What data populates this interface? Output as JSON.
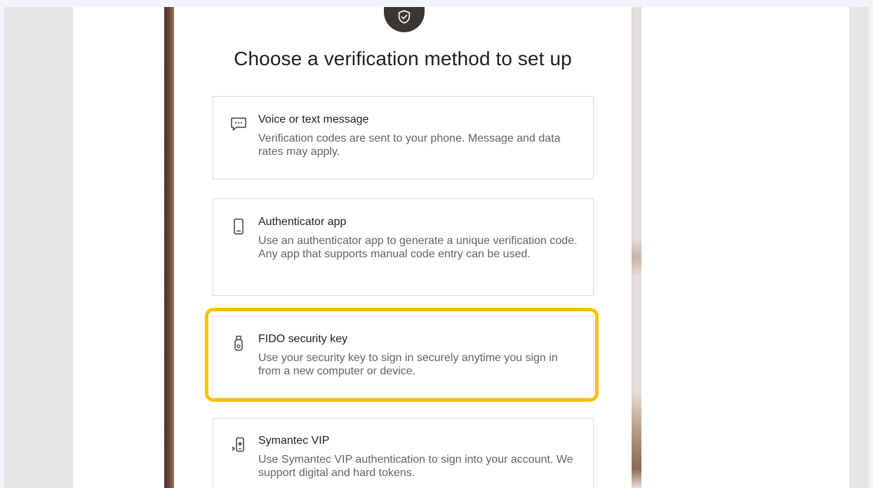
{
  "page": {
    "title": "Choose a verification method to set up"
  },
  "options": [
    {
      "title": "Voice or text message",
      "description": "Verification codes are sent to your phone. Message and data rates may apply.",
      "icon": "message-icon"
    },
    {
      "title": "Authenticator app",
      "description": "Use an authenticator app to generate a unique verification code. Any app that supports manual code entry can be used.",
      "icon": "phone-icon"
    },
    {
      "title": "FIDO security key",
      "description": "Use your security key to sign in securely anytime you sign in from a new computer or device.",
      "icon": "usb-key-icon"
    },
    {
      "title": "Symantec VIP",
      "description": "Use Symantec VIP authentication to sign into your account. We support digital and hard tokens.",
      "icon": "token-icon"
    }
  ],
  "colors": {
    "highlight": "#fcc200",
    "badge": "#3a3634",
    "title_text": "#1f1f1f",
    "desc_text": "#5f6368",
    "card_border": "#dcdcdc"
  }
}
